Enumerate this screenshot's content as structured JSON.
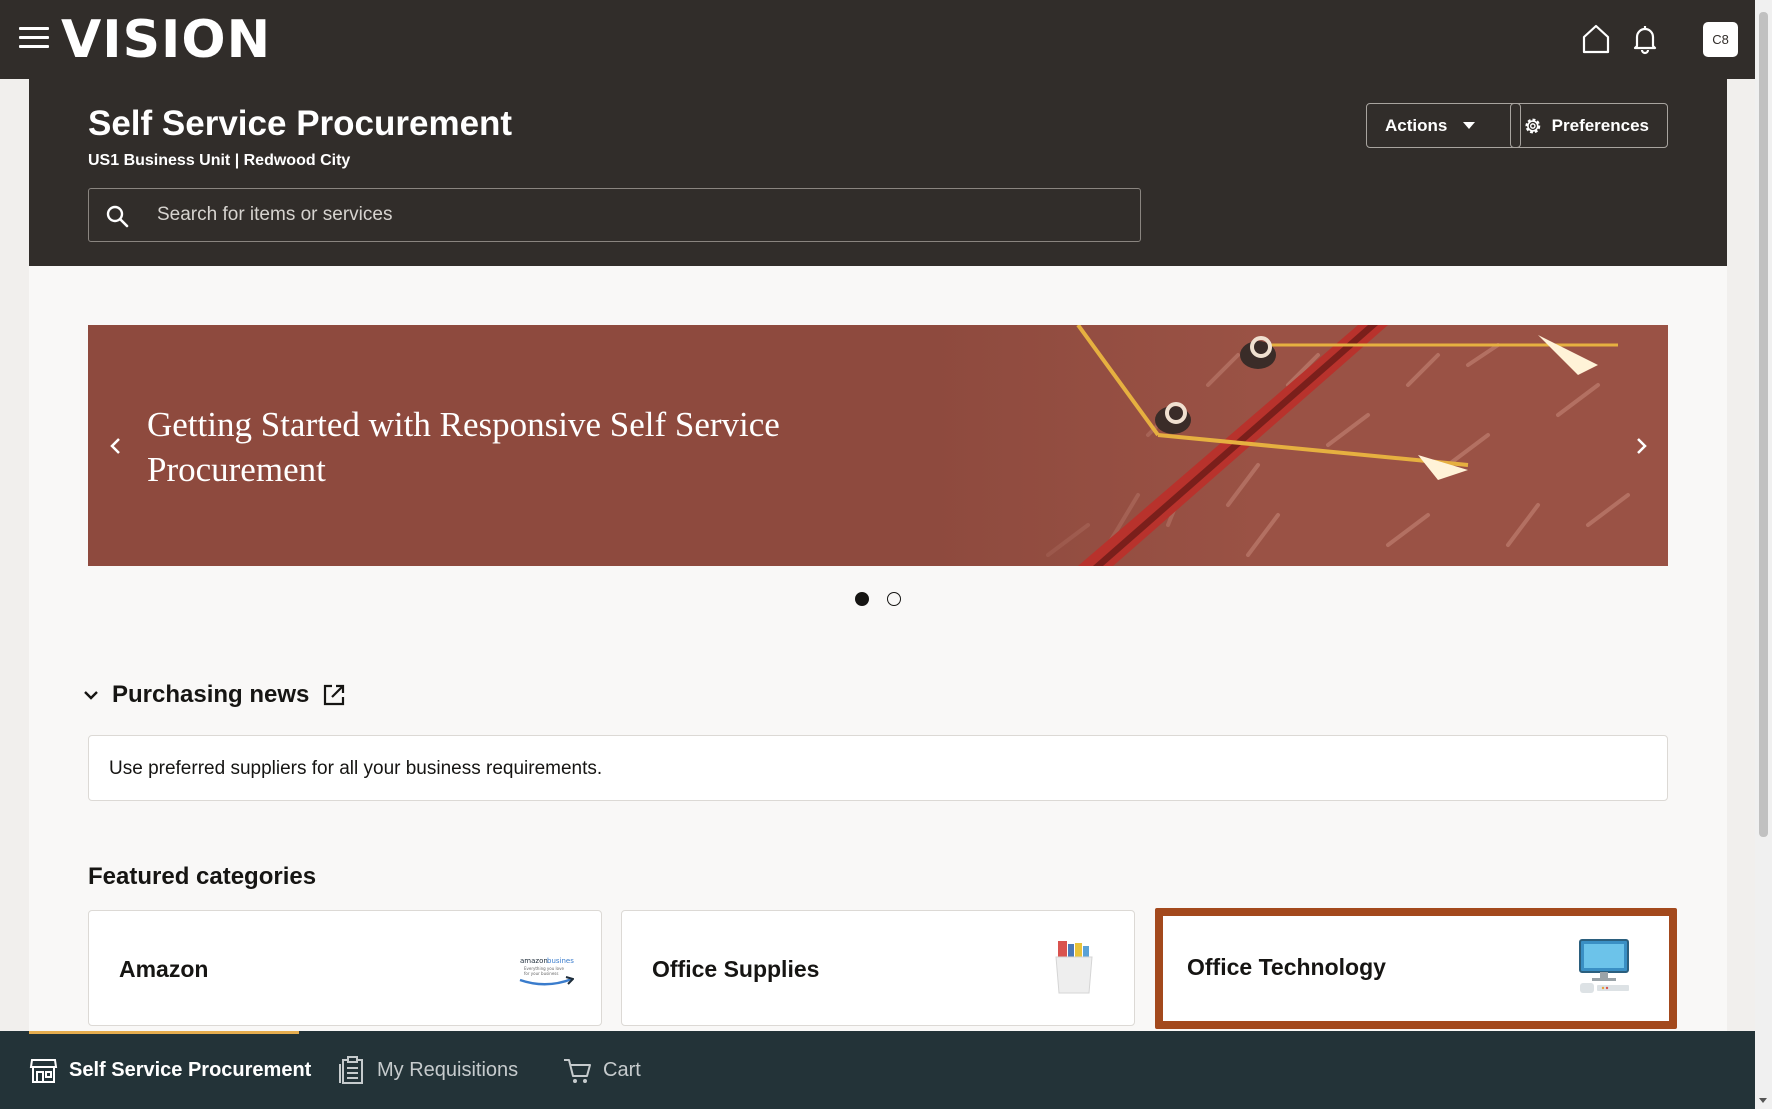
{
  "topbar": {
    "logo": "VISION",
    "avatar_initials": "C8"
  },
  "header": {
    "title": "Self Service Procurement",
    "subtitle": "US1 Business Unit | Redwood City",
    "search_placeholder": "Search for items or services",
    "actions_label": "Actions",
    "preferences_label": "Preferences"
  },
  "banner": {
    "title": "Getting Started with Responsive Self Service Procurement",
    "slide_count": 2,
    "active_slide": 1
  },
  "news": {
    "title": "Purchasing news",
    "message": "Use preferred suppliers for all your business requirements."
  },
  "featured": {
    "title": "Featured categories",
    "categories": [
      {
        "label": "Amazon",
        "icon": "amazon-logo"
      },
      {
        "label": "Office Supplies",
        "icon": "pen-cup-icon"
      },
      {
        "label": "Office Technology",
        "icon": "computer-icon",
        "selected": true
      }
    ]
  },
  "bottom_nav": {
    "items": [
      {
        "label": "Self Service Procurement",
        "icon": "store-icon",
        "active": true
      },
      {
        "label": "My Requisitions",
        "icon": "requisitions-icon"
      },
      {
        "label": "Cart",
        "icon": "cart-icon"
      }
    ]
  },
  "colors": {
    "header_bg": "#312d2a",
    "banner_bg": "#8e4a3e",
    "bottom_nav_bg": "#233338",
    "active_nav_underline": "#e5ad4f",
    "selection_border": "#a3491d"
  }
}
